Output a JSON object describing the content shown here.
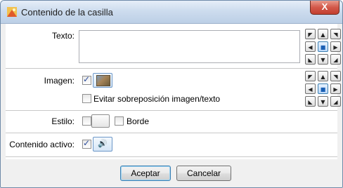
{
  "window": {
    "title": "Contenido de la casilla",
    "close_glyph": "X"
  },
  "texto": {
    "label": "Texto:",
    "value": ""
  },
  "imagen": {
    "label": "Imagen:",
    "checked": true,
    "avoid_overlap_label": "Evitar sobreposición imagen/texto",
    "avoid_overlap_checked": false
  },
  "estilo": {
    "label": "Estilo:",
    "checked": false,
    "border_label": "Borde",
    "border_checked": false
  },
  "contenido_activo": {
    "label": "Contenido activo:",
    "checked": true
  },
  "alignment": {
    "glyphs": [
      "◤",
      "▲",
      "◥",
      "◀",
      "■",
      "▶",
      "◣",
      "▼",
      "◢"
    ],
    "selected_index": 4
  },
  "buttons": {
    "accept": "Aceptar",
    "cancel": "Cancelar"
  }
}
